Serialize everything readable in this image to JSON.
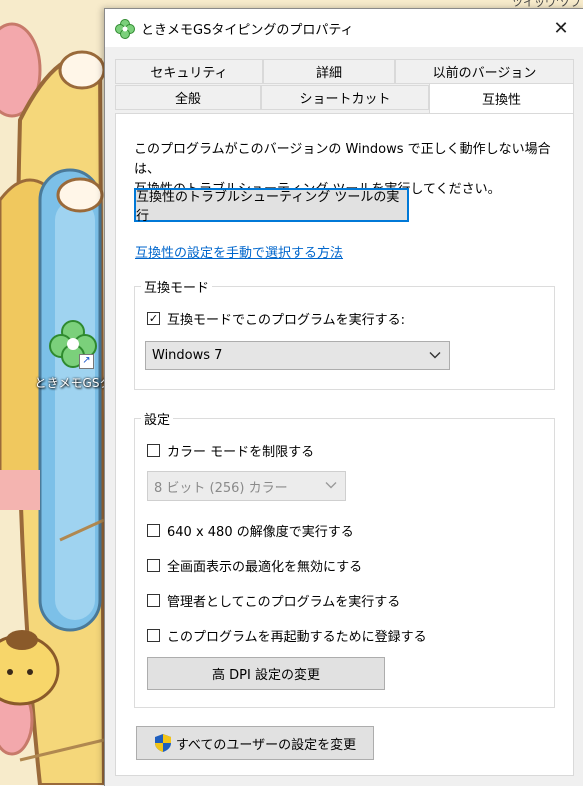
{
  "desktop": {
    "top_right_text": "ツイッワ'ソフ",
    "icon_label": "ときメモGSタ"
  },
  "window": {
    "title": "ときメモGSタイピングのプロパティ",
    "close_glyph": "✕"
  },
  "tabs": {
    "row1": [
      "セキュリティ",
      "詳細",
      "以前のバージョン"
    ],
    "row2": [
      "全般",
      "ショートカット",
      "互換性"
    ],
    "active": "互換性"
  },
  "compat": {
    "description_line1": "このプログラムがこのバージョンの Windows で正しく動作しない場合は、",
    "description_line2": "互換性のトラブルシューティング ツールを実行してください。",
    "troubleshoot_button": "互換性のトラブルシューティング ツールの実行",
    "manual_link": "互換性の設定を手動で選択する方法",
    "mode_group": {
      "title": "互換モード",
      "run_checkbox_label": "互換モードでこのプログラムを実行する:",
      "run_checked": true,
      "os_select_value": "Windows 7"
    },
    "settings_group": {
      "title": "設定",
      "reduced_color_label": "カラー モードを制限する",
      "color_select_value": "8 ビット (256) カラー",
      "res_640_label": "640 x 480 の解像度で実行する",
      "disable_fullscreen_label": "全画面表示の最適化を無効にする",
      "run_as_admin_label": "管理者としてこのプログラムを実行する",
      "register_restart_label": "このプログラムを再起動するために登録する",
      "high_dpi_button": "高 DPI 設定の変更"
    },
    "all_users_button": "すべてのユーザーの設定を変更"
  },
  "icons": {
    "check": "✓",
    "chevron": "⌄"
  },
  "colors": {
    "accent": "#0078d7",
    "link": "#0066cc",
    "shield_blue": "#1f5fbf",
    "shield_yellow": "#f2c418"
  }
}
